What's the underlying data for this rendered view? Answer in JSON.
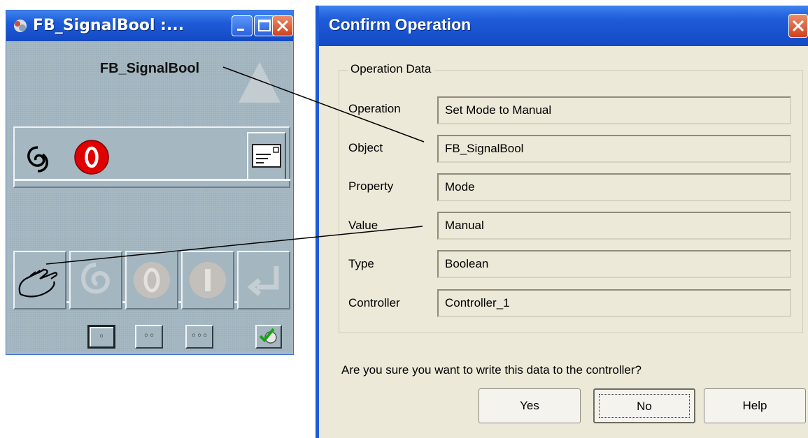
{
  "faceplate": {
    "title": "FB_SignalBool :...",
    "object_name": "FB_SignalBool",
    "icons": [
      "process-icon",
      "spiral-icon",
      "stop-icon",
      "message-icon"
    ],
    "operator_buttons": [
      "hand-icon",
      "auto-icon",
      "off-icon",
      "on-icon",
      "enter-icon"
    ],
    "view_buttons": [
      "◦",
      "◦◦",
      "◦◦◦"
    ],
    "tool_icon": "check-tools-icon"
  },
  "dialog": {
    "title": "Confirm Operation",
    "group_label": "Operation Data",
    "rows": [
      {
        "label": "Operation",
        "value": "Set Mode to Manual"
      },
      {
        "label": "Object",
        "value": "FB_SignalBool"
      },
      {
        "label": "Property",
        "value": "Mode"
      },
      {
        "label": "Value",
        "value": "Manual"
      },
      {
        "label": "Type",
        "value": "Boolean"
      },
      {
        "label": "Controller",
        "value": "Controller_1"
      }
    ],
    "question": "Are you sure you want to write this data to the controller?",
    "buttons": {
      "yes": "Yes",
      "no": "No",
      "help": "Help"
    }
  },
  "colors": {
    "titlebar": "#1e5bd8",
    "faceplate_bg": "#a7b9c3",
    "dialog_bg": "#ece9d8",
    "stop_red": "#e00000"
  }
}
